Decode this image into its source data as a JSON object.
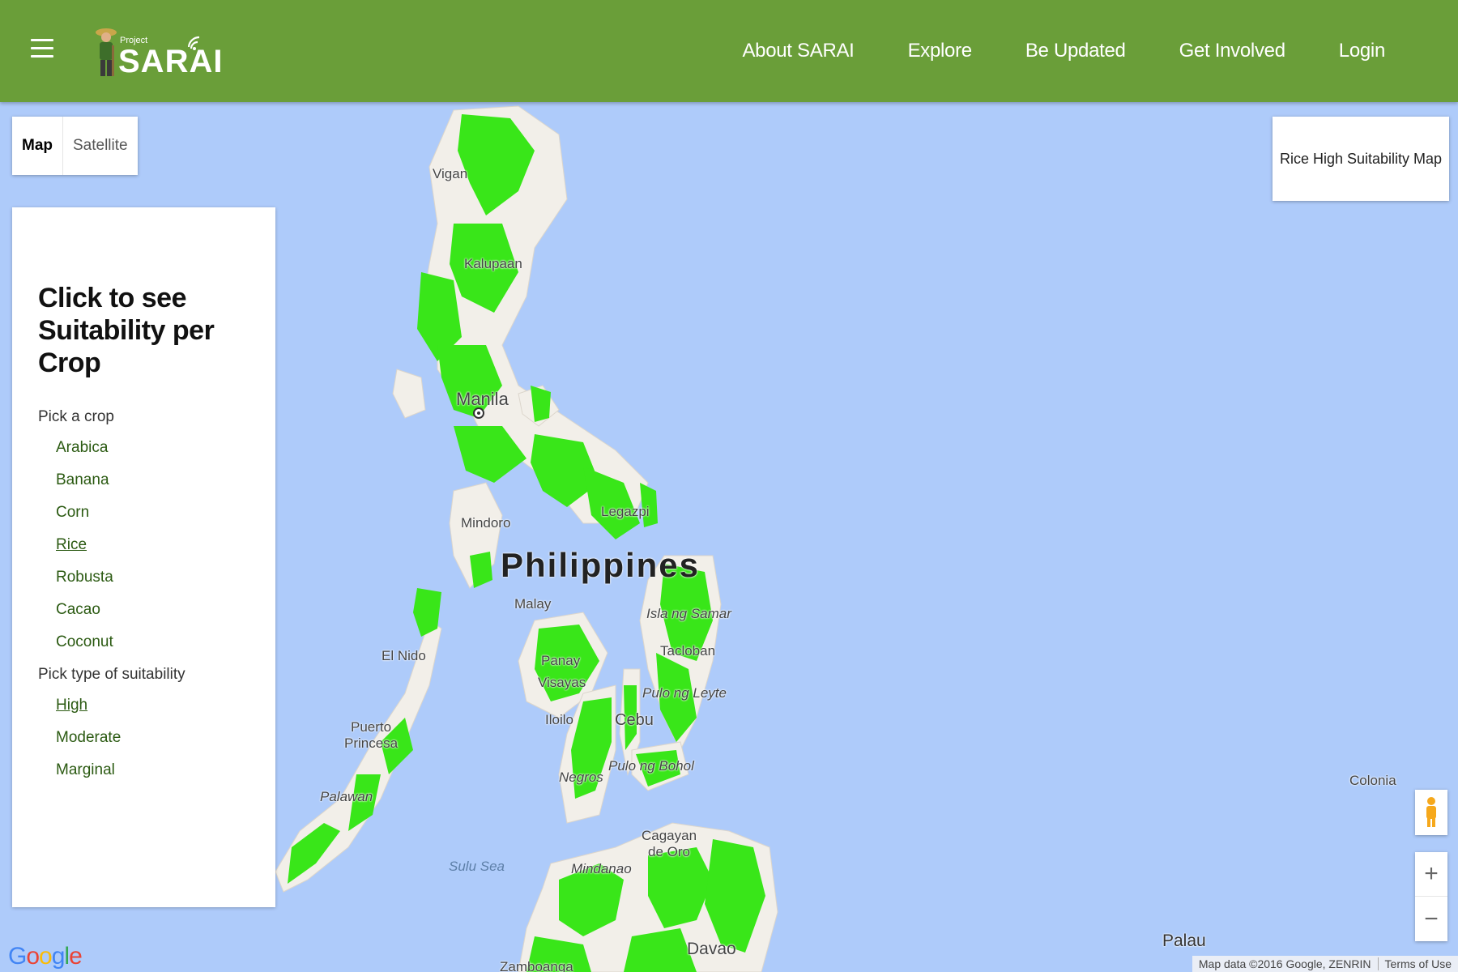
{
  "header": {
    "logo_small": "Project",
    "logo_brand": "SARAI",
    "nav": [
      "About SARAI",
      "Explore",
      "Be Updated",
      "Get Involved",
      "Login"
    ]
  },
  "map": {
    "type_buttons": [
      "Map",
      "Satellite"
    ],
    "active_type": "Map",
    "title": "Rice High Suitability Map",
    "labels": {
      "vigan": "Vigan",
      "kalupaan": "Kalupaan",
      "manila": "Manila",
      "mindoro": "Mindoro",
      "philippines": "Philippines",
      "legazpi": "Legazpi",
      "malay": "Malay",
      "samar": "Isla ng Samar",
      "el_nido": "El Nido",
      "panay": "Panay",
      "visayas": "Visayas",
      "tacloban": "Tacloban",
      "leyte": "Pulo ng Leyte",
      "iloilo": "Iloilo",
      "cebu": "Cebu",
      "puerto_princesa": "Puerto\nPrincesa",
      "negros": "Negros",
      "bohol": "Pulo ng Bohol",
      "palawan": "Palawan",
      "sulu_sea": "Sulu Sea",
      "cagayan": "Cagayan\nde Oro",
      "mindanao": "Mindanao",
      "davao": "Davao",
      "zamboanga": "Zamboanga",
      "colonia": "Colonia",
      "palau": "Palau"
    },
    "attribution": "Map data ©2016 Google, ZENRIN",
    "terms": "Terms of Use",
    "google_logo": "Google",
    "zoom_in": "+",
    "zoom_out": "−",
    "colors": {
      "water": "#aecbfa",
      "land": "#f2efe9",
      "suitable": "#39e619"
    }
  },
  "panel": {
    "heading": "Click to see Suitability per Crop",
    "crop_label": "Pick a crop",
    "crops": [
      "Arabica",
      "Banana",
      "Corn",
      "Rice",
      "Robusta",
      "Cacao",
      "Coconut"
    ],
    "selected_crop": "Rice",
    "suitability_label": "Pick type of suitability",
    "suitability": [
      "High",
      "Moderate",
      "Marginal"
    ],
    "selected_suitability": "High"
  }
}
